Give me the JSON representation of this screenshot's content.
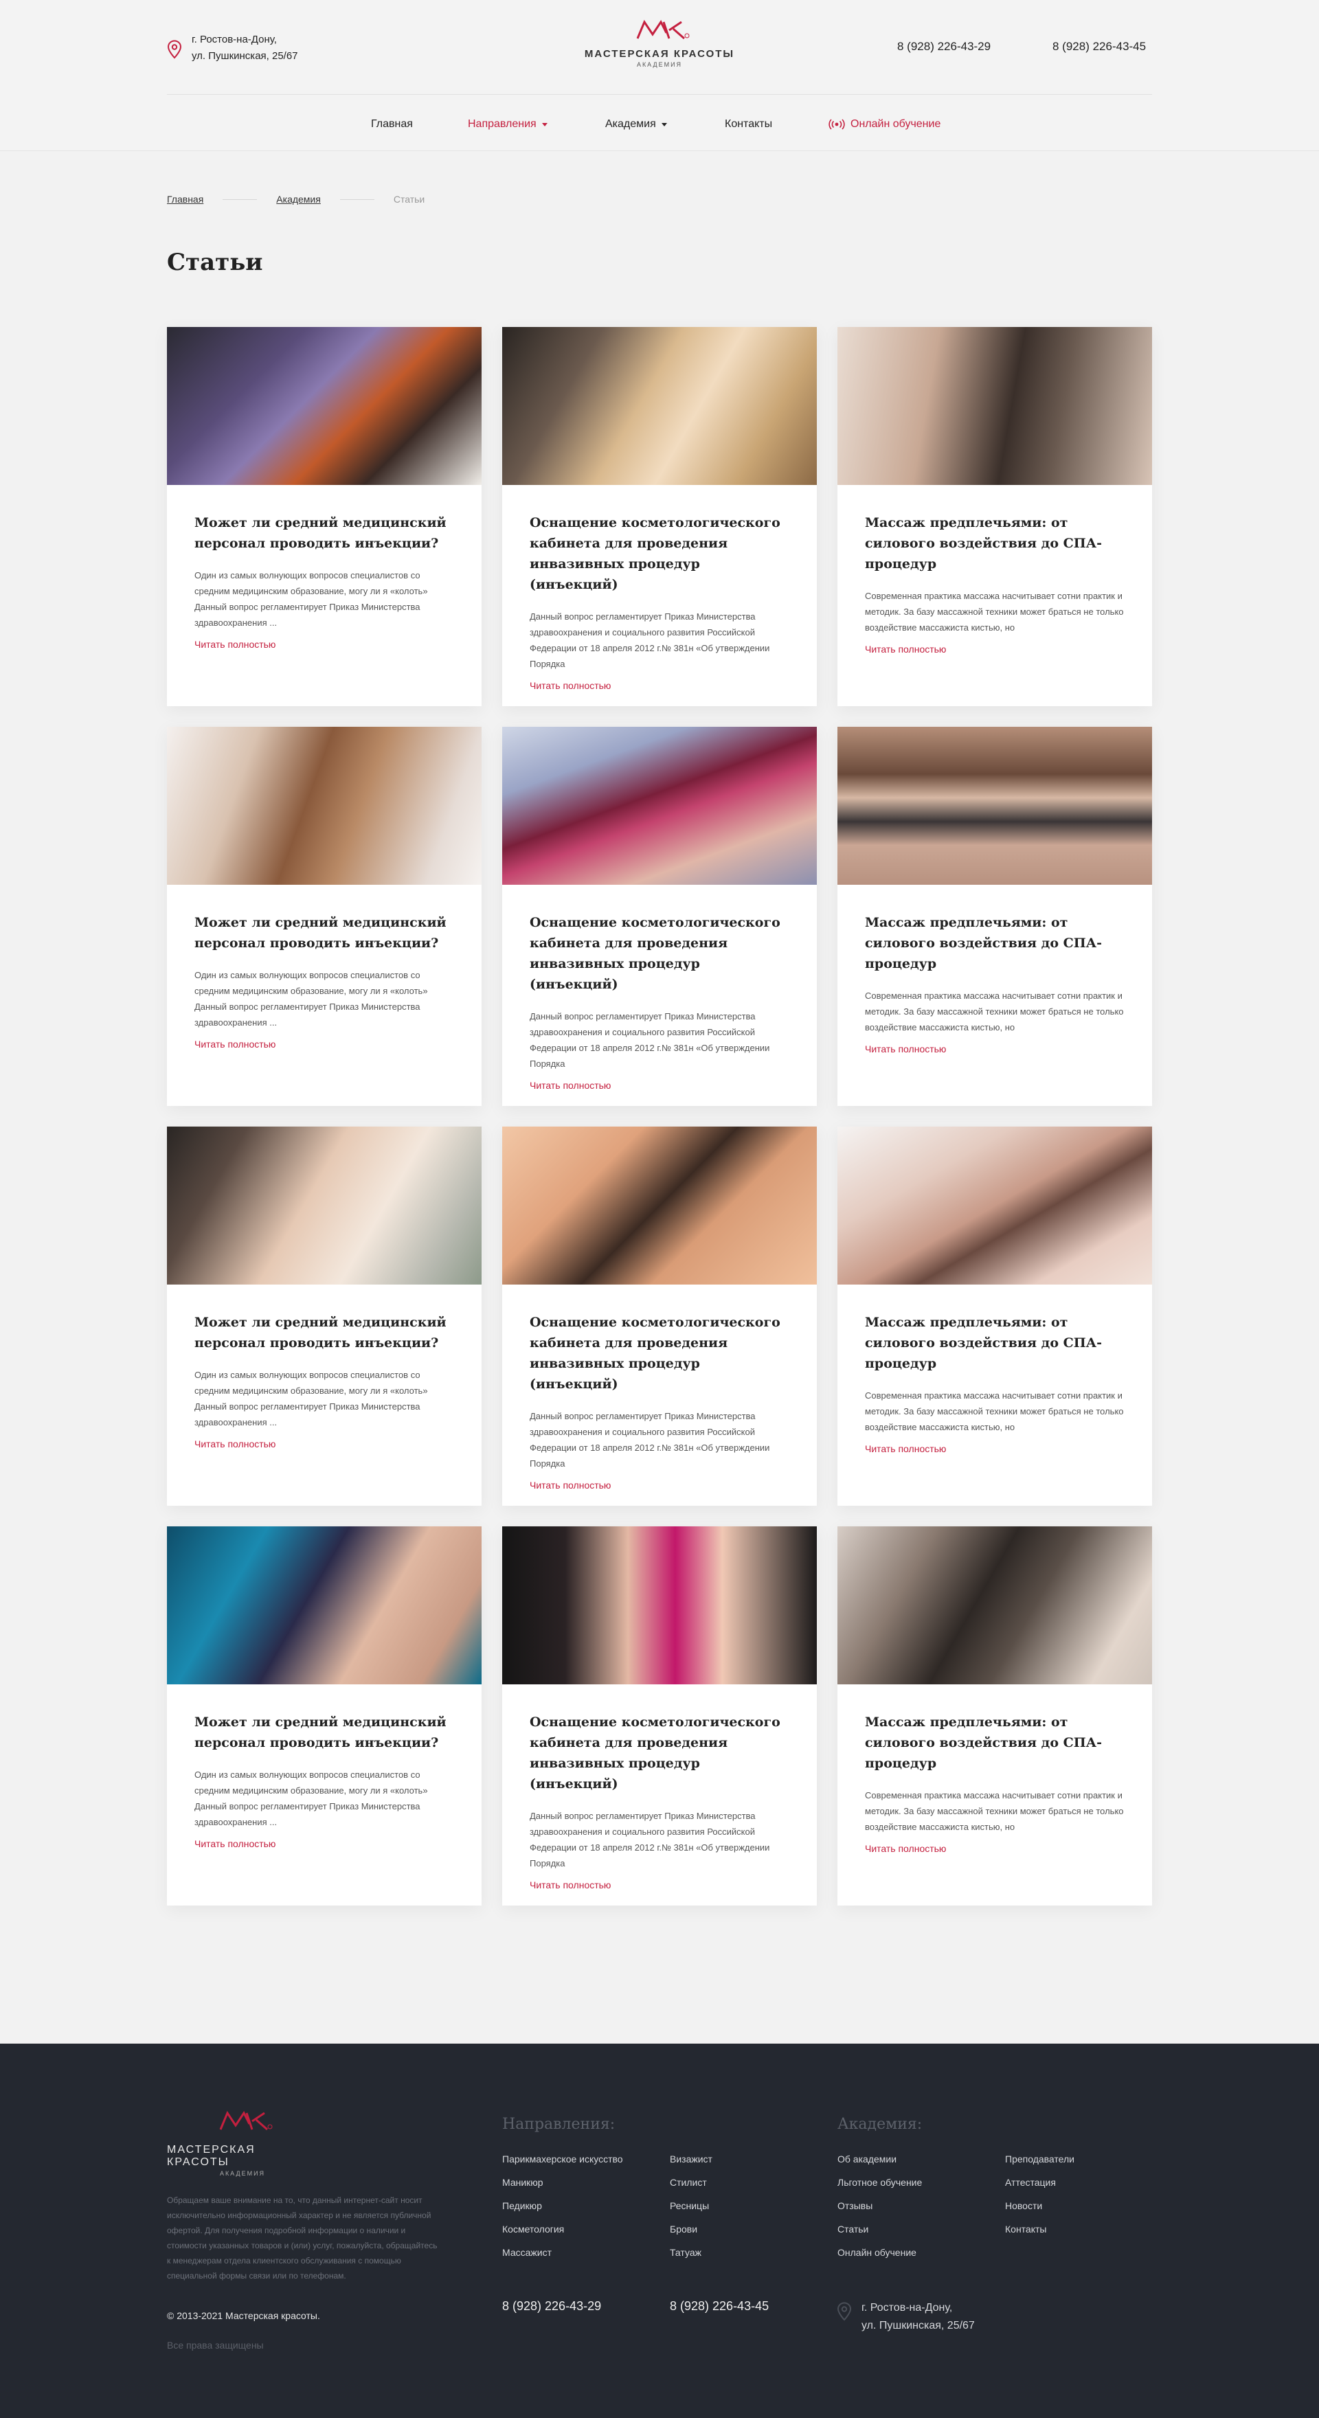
{
  "header": {
    "address_line1": "г. Ростов-на-Дону,",
    "address_line2": "ул. Пушкинская, 25/67",
    "logo_title": "МАСТЕРСКАЯ КРАСОТЫ",
    "logo_subtitle": "АКАДЕМИЯ",
    "phone1": "8 (928) 226-43-29",
    "phone2": "8 (928) 226-43-45"
  },
  "nav": {
    "items": [
      {
        "label": "Главная"
      },
      {
        "label": "Направления"
      },
      {
        "label": "Академия"
      },
      {
        "label": "Контакты"
      },
      {
        "label": "Онлайн обучение"
      }
    ]
  },
  "breadcrumb": {
    "items": [
      "Главная",
      "Академия",
      "Статьи"
    ]
  },
  "page_title": "Статьи",
  "articles": {
    "read_more": "Читать полностью",
    "a": {
      "title": "Может ли средний медицинский персонал проводить инъекции?",
      "excerpt": "Один из самых волнующих вопросов специалистов со средним медицинским образование, могу ли я «колоть» Данный вопрос регламентирует Приказ Министерства здравоохранения ..."
    },
    "b": {
      "title": "Оснащение косметологического кабинета для проведения инвазивных процедур (инъекций)",
      "excerpt": "Данный вопрос регламентирует Приказ Министерства здравоохранения и социального развития Российской Федерации от 18 апреля 2012 г.№ 381н «Об утверждении Порядка"
    },
    "c": {
      "title": "Массаж предплечьями: от силового воздействия до СПА-процедур",
      "excerpt": "Современная практика массажа насчитывает сотни практик и методик. За базу массажной техники может браться не только воздействие массажиста кистью, но"
    }
  },
  "footer": {
    "logo_title": "МАСТЕРСКАЯ КРАСОТЫ",
    "logo_subtitle": "АКАДЕМИЯ",
    "note": "Обращаем ваше внимание на то, что данный интернет-сайт носит исключительно информационный характер и не является публичной офертой. Для получения подробной информации о наличии и стоимости указанных товаров и (или) услуг, пожалуйста, обращайтесь к менеджерам отдела клиентского обслуживания с помощью специальной формы связи или по телефонам.",
    "copyright": "© 2013-2021 Мастерская красоты.",
    "rights": "Все права защищены",
    "directions_title": "Направления:",
    "directions_col1": [
      "Парикмахерское искусство",
      "Маникюр",
      "Педикюр",
      "Косметология",
      "Массажист"
    ],
    "directions_col2": [
      "Визажист",
      "Стилист",
      "Ресницы",
      "Брови",
      "Татуаж"
    ],
    "academy_title": "Академия:",
    "academy_col1": [
      "Об академии",
      "Льготное обучение",
      "Отзывы",
      "Статьи",
      "Онлайн обучение"
    ],
    "academy_col2": [
      "Преподаватели",
      "Аттестация",
      "Новости",
      "Контакты"
    ],
    "phone1": "8 (928) 226-43-29",
    "phone2": "8 (928) 226-43-45",
    "address_line1": "г. Ростов-на-Дону,",
    "address_line2": "ул. Пушкинская, 25/67"
  },
  "colors": {
    "accent": "#c4203f",
    "footer_bg": "#242830",
    "page_bg": "#f2f2f2"
  },
  "icons": {
    "pin": "map-pin-icon",
    "live": "broadcast-icon",
    "caret": "chevron-down-icon"
  }
}
